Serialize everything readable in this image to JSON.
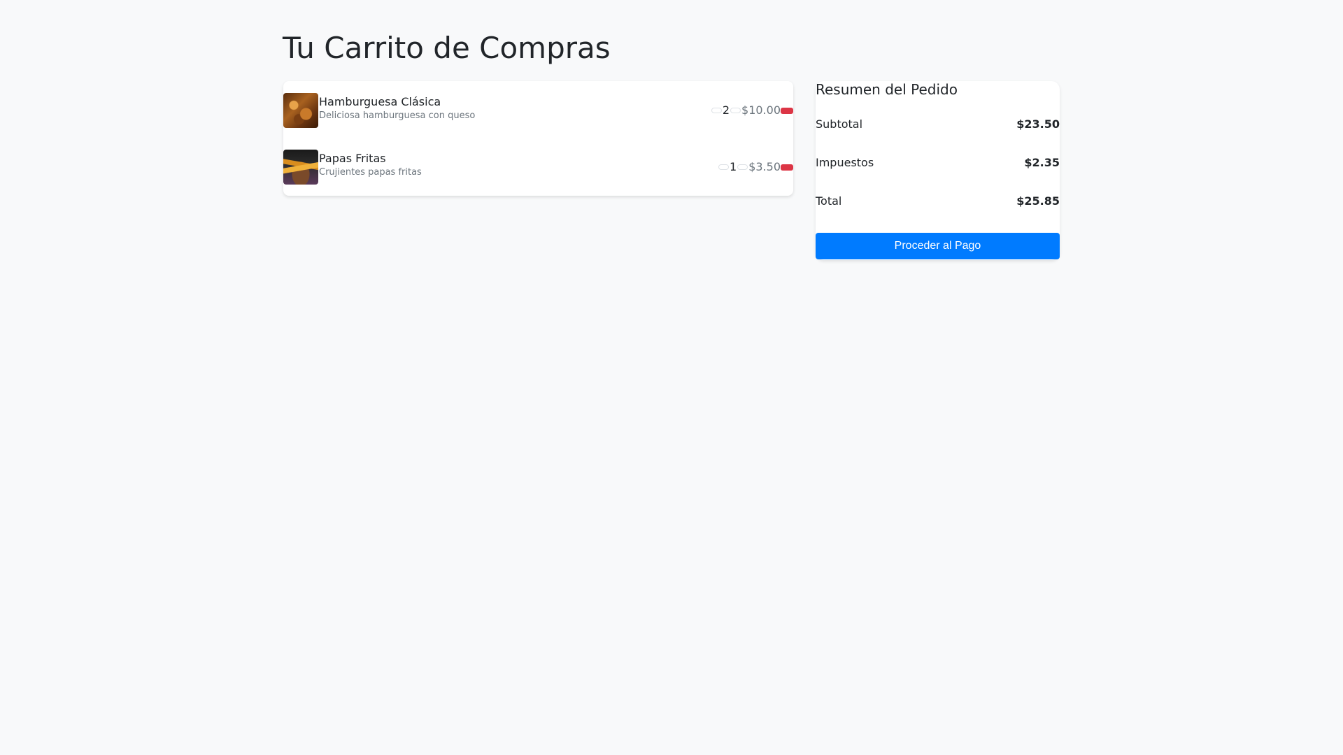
{
  "page": {
    "title": "Tu Carrito de Compras"
  },
  "cart": {
    "items": [
      {
        "name": "Hamburguesa Clásica",
        "description": "Deliciosa hamburguesa con queso",
        "quantity": "2",
        "price": "$10.00",
        "image": "burger-photo"
      },
      {
        "name": "Papas Fritas",
        "description": "Crujientes papas fritas",
        "quantity": "1",
        "price": "$3.50",
        "image": "fries-photo"
      }
    ]
  },
  "summary": {
    "title": "Resumen del Pedido",
    "subtotal_label": "Subtotal",
    "subtotal_value": "$23.50",
    "tax_label": "Impuestos",
    "tax_value": "$2.35",
    "total_label": "Total",
    "total_value": "$25.85",
    "checkout_label": "Proceder al Pago"
  },
  "colors": {
    "background": "#f8f9fa",
    "primary": "#007bff",
    "danger": "#dc3545",
    "muted": "#6c757d"
  }
}
